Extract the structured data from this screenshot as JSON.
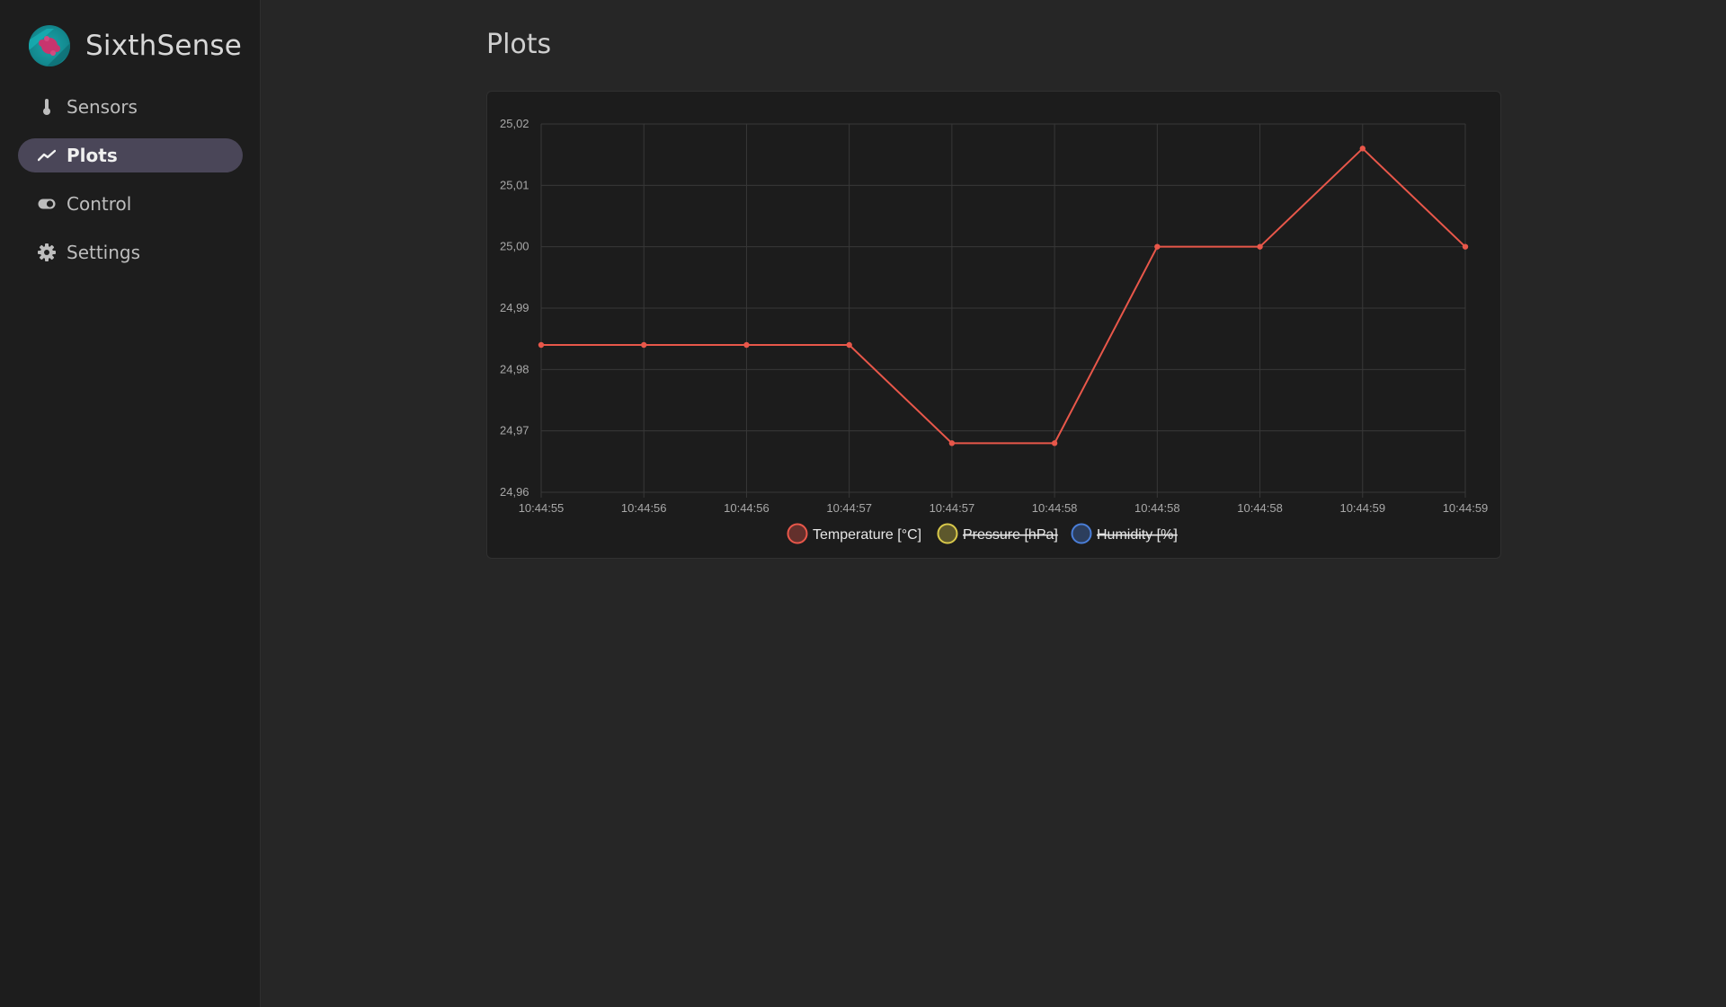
{
  "app": {
    "name": "SixthSense"
  },
  "nav": {
    "items": [
      {
        "label": "Sensors",
        "icon": "thermometer-icon"
      },
      {
        "label": "Plots",
        "icon": "chart-line-icon",
        "active": true
      },
      {
        "label": "Control",
        "icon": "toggle-icon"
      },
      {
        "label": "Settings",
        "icon": "gear-icon"
      }
    ]
  },
  "page": {
    "title": "Plots"
  },
  "colors": {
    "accent": "#4a4658",
    "temperature": "#e8574a",
    "pressure": "#d8c84a",
    "humidity": "#4a7ed8"
  },
  "chart_data": {
    "type": "line",
    "x": [
      "10:44:55",
      "10:44:56",
      "10:44:56",
      "10:44:57",
      "10:44:57",
      "10:44:58",
      "10:44:58",
      "10:44:58",
      "10:44:59",
      "10:44:59"
    ],
    "series": [
      {
        "name": "Temperature [°C]",
        "values": [
          24.984,
          24.984,
          24.984,
          24.984,
          24.968,
          24.968,
          25.0,
          25.0,
          25.016,
          25.0
        ],
        "visible": true
      },
      {
        "name": "Pressure [hPa]",
        "values": [],
        "visible": false
      },
      {
        "name": "Humidity [%]",
        "values": [],
        "visible": false
      }
    ],
    "ylim": [
      24.96,
      25.02
    ],
    "yticks": [
      "25,02",
      "25,01",
      "25,00",
      "24,99",
      "24,98",
      "24,97",
      "24,96"
    ],
    "grid": true,
    "legend": "bottom"
  }
}
